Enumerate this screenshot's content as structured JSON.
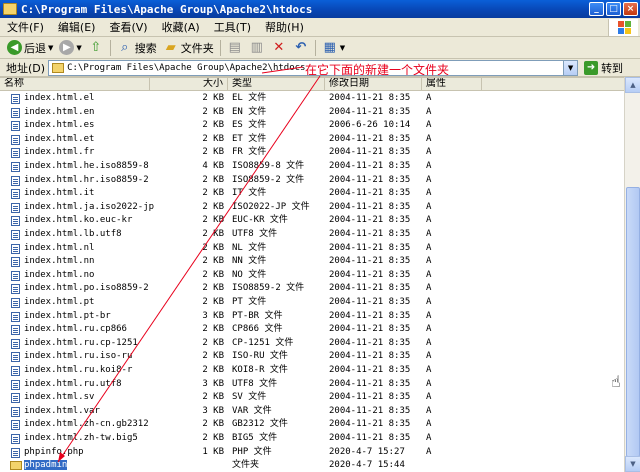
{
  "window": {
    "title": "C:\\Program Files\\Apache Group\\Apache2\\htdocs"
  },
  "window_buttons": {
    "minimize": "_",
    "maximize": "□",
    "close": "×"
  },
  "menu": [
    "文件(F)",
    "编辑(E)",
    "查看(V)",
    "收藏(A)",
    "工具(T)",
    "帮助(H)"
  ],
  "toolbar": {
    "back": "后退",
    "search": "搜索",
    "folders": "文件夹"
  },
  "address": {
    "label": "地址(D)",
    "path": "C:\\Program Files\\Apache Group\\Apache2\\htdocs",
    "go": "转到"
  },
  "annotation": "在它下面的新建一个文件夹",
  "columns": {
    "name": "名称",
    "size": "大小",
    "type": "类型",
    "modified": "修改日期",
    "attr": "属性"
  },
  "colors": {
    "annotation": "#e8001c",
    "selection": "#316ac5",
    "titlebar": "#0845b3"
  },
  "files": [
    {
      "name": "index.html.el",
      "size": "2 KB",
      "type": "EL 文件",
      "date": "2004-11-21 8:35",
      "attr": "A",
      "icon": "file-icon"
    },
    {
      "name": "index.html.en",
      "size": "2 KB",
      "type": "EN 文件",
      "date": "2004-11-21 8:35",
      "attr": "A",
      "icon": "file-icon"
    },
    {
      "name": "index.html.es",
      "size": "2 KB",
      "type": "ES 文件",
      "date": "2006-6-26 10:14",
      "attr": "A",
      "icon": "file-icon"
    },
    {
      "name": "index.html.et",
      "size": "2 KB",
      "type": "ET 文件",
      "date": "2004-11-21 8:35",
      "attr": "A",
      "icon": "file-icon"
    },
    {
      "name": "index.html.fr",
      "size": "2 KB",
      "type": "FR 文件",
      "date": "2004-11-21 8:35",
      "attr": "A",
      "icon": "file-icon"
    },
    {
      "name": "index.html.he.iso8859-8",
      "size": "4 KB",
      "type": "ISO8859-8 文件",
      "date": "2004-11-21 8:35",
      "attr": "A",
      "icon": "file-icon"
    },
    {
      "name": "index.html.hr.iso8859-2",
      "size": "2 KB",
      "type": "ISO8859-2 文件",
      "date": "2004-11-21 8:35",
      "attr": "A",
      "icon": "file-icon"
    },
    {
      "name": "index.html.it",
      "size": "2 KB",
      "type": "IT 文件",
      "date": "2004-11-21 8:35",
      "attr": "A",
      "icon": "file-icon"
    },
    {
      "name": "index.html.ja.iso2022-jp",
      "size": "2 KB",
      "type": "ISO2022-JP 文件",
      "date": "2004-11-21 8:35",
      "attr": "A",
      "icon": "file-icon"
    },
    {
      "name": "index.html.ko.euc-kr",
      "size": "2 KB",
      "type": "EUC-KR 文件",
      "date": "2004-11-21 8:35",
      "attr": "A",
      "icon": "file-icon"
    },
    {
      "name": "index.html.lb.utf8",
      "size": "2 KB",
      "type": "UTF8 文件",
      "date": "2004-11-21 8:35",
      "attr": "A",
      "icon": "file-icon"
    },
    {
      "name": "index.html.nl",
      "size": "2 KB",
      "type": "NL 文件",
      "date": "2004-11-21 8:35",
      "attr": "A",
      "icon": "file-icon"
    },
    {
      "name": "index.html.nn",
      "size": "2 KB",
      "type": "NN 文件",
      "date": "2004-11-21 8:35",
      "attr": "A",
      "icon": "file-icon"
    },
    {
      "name": "index.html.no",
      "size": "2 KB",
      "type": "NO 文件",
      "date": "2004-11-21 8:35",
      "attr": "A",
      "icon": "file-icon"
    },
    {
      "name": "index.html.po.iso8859-2",
      "size": "2 KB",
      "type": "ISO8859-2 文件",
      "date": "2004-11-21 8:35",
      "attr": "A",
      "icon": "file-icon"
    },
    {
      "name": "index.html.pt",
      "size": "2 KB",
      "type": "PT 文件",
      "date": "2004-11-21 8:35",
      "attr": "A",
      "icon": "file-icon"
    },
    {
      "name": "index.html.pt-br",
      "size": "3 KB",
      "type": "PT-BR 文件",
      "date": "2004-11-21 8:35",
      "attr": "A",
      "icon": "file-icon"
    },
    {
      "name": "index.html.ru.cp866",
      "size": "2 KB",
      "type": "CP866 文件",
      "date": "2004-11-21 8:35",
      "attr": "A",
      "icon": "file-icon"
    },
    {
      "name": "index.html.ru.cp-1251",
      "size": "2 KB",
      "type": "CP-1251 文件",
      "date": "2004-11-21 8:35",
      "attr": "A",
      "icon": "file-icon"
    },
    {
      "name": "index.html.ru.iso-ru",
      "size": "2 KB",
      "type": "ISO-RU 文件",
      "date": "2004-11-21 8:35",
      "attr": "A",
      "icon": "file-icon"
    },
    {
      "name": "index.html.ru.koi8-r",
      "size": "2 KB",
      "type": "KOI8-R 文件",
      "date": "2004-11-21 8:35",
      "attr": "A",
      "icon": "file-icon"
    },
    {
      "name": "index.html.ru.utf8",
      "size": "3 KB",
      "type": "UTF8 文件",
      "date": "2004-11-21 8:35",
      "attr": "A",
      "icon": "file-icon"
    },
    {
      "name": "index.html.sv",
      "size": "2 KB",
      "type": "SV 文件",
      "date": "2004-11-21 8:35",
      "attr": "A",
      "icon": "file-icon"
    },
    {
      "name": "index.html.var",
      "size": "3 KB",
      "type": "VAR 文件",
      "date": "2004-11-21 8:35",
      "attr": "A",
      "icon": "file-icon"
    },
    {
      "name": "index.html.zh-cn.gb2312",
      "size": "2 KB",
      "type": "GB2312 文件",
      "date": "2004-11-21 8:35",
      "attr": "A",
      "icon": "file-icon"
    },
    {
      "name": "index.html.zh-tw.big5",
      "size": "2 KB",
      "type": "BIG5 文件",
      "date": "2004-11-21 8:35",
      "attr": "A",
      "icon": "file-icon"
    },
    {
      "name": "phpinfo.php",
      "size": "1 KB",
      "type": "PHP 文件",
      "date": "2020-4-7 15:27",
      "attr": "A",
      "icon": "file-icon"
    },
    {
      "name": "phpadmin",
      "size": "",
      "type": "文件夹",
      "date": "2020-4-7 15:44",
      "attr": "",
      "icon": "folder-icon",
      "selected": true
    }
  ]
}
